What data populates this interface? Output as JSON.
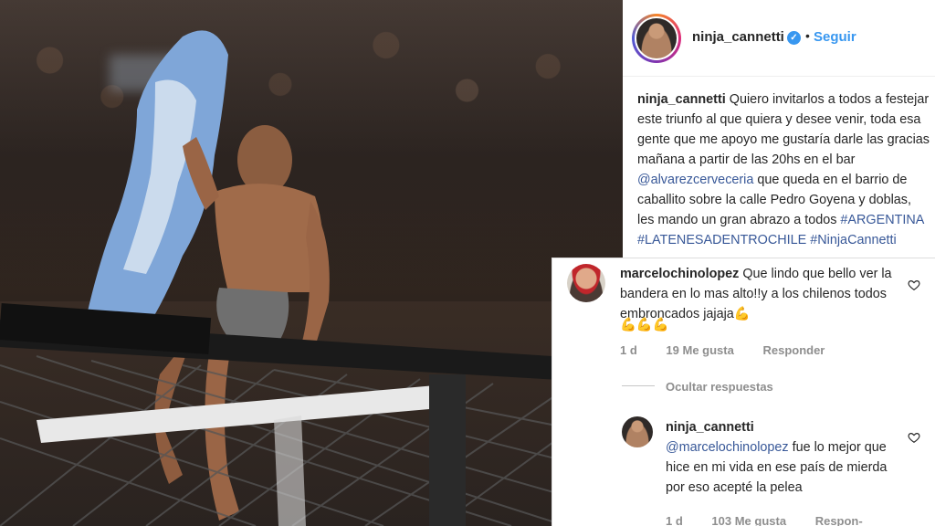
{
  "post": {
    "username": "ninja_cannetti",
    "verified_icon": "verified-badge-icon",
    "separator": "•",
    "follow_label": "Seguir",
    "caption_user": "ninja_cannetti",
    "caption_text_1": "Quiero invitarlos a todos a festejar este triunfo al que quiera y desee venir, toda esa gente que me apoyo me gustaría darle las gracias mañana a partir de las 20hs en el bar",
    "caption_mention": "@alvarezcerveceria",
    "caption_text_2": "que queda en el barrio de caballito sobre la calle Pedro Goyena y doblas, les mando un gran abrazo a todos",
    "hashtag_1": "#ARGENTINA",
    "hashtag_2": "#LATENESADENTROCHILE",
    "hashtag_3": "#NinjaCannetti"
  },
  "comments": [
    {
      "username": "marcelochinolopez",
      "text": "Que lindo que bello ver la bandera en lo mas alto!!y a los chilenos todos embroncados jajaja💪",
      "emoji_line": "💪💪💪",
      "time": "1 d",
      "likes": "19 Me gusta",
      "reply": "Responder"
    }
  ],
  "hide_replies": "Ocultar respuestas",
  "reply": {
    "username": "ninja_cannetti",
    "mention": "@marcelochinolopez",
    "text": "fue lo mejor que hice en mi vida en ese país de mierda por eso acepté la pelea",
    "time": "1 d",
    "likes": "103 Me gusta",
    "reply": "Respon-"
  },
  "colors": {
    "link": "#385898",
    "follow": "#3897f0",
    "muted": "#8e8e8e"
  }
}
